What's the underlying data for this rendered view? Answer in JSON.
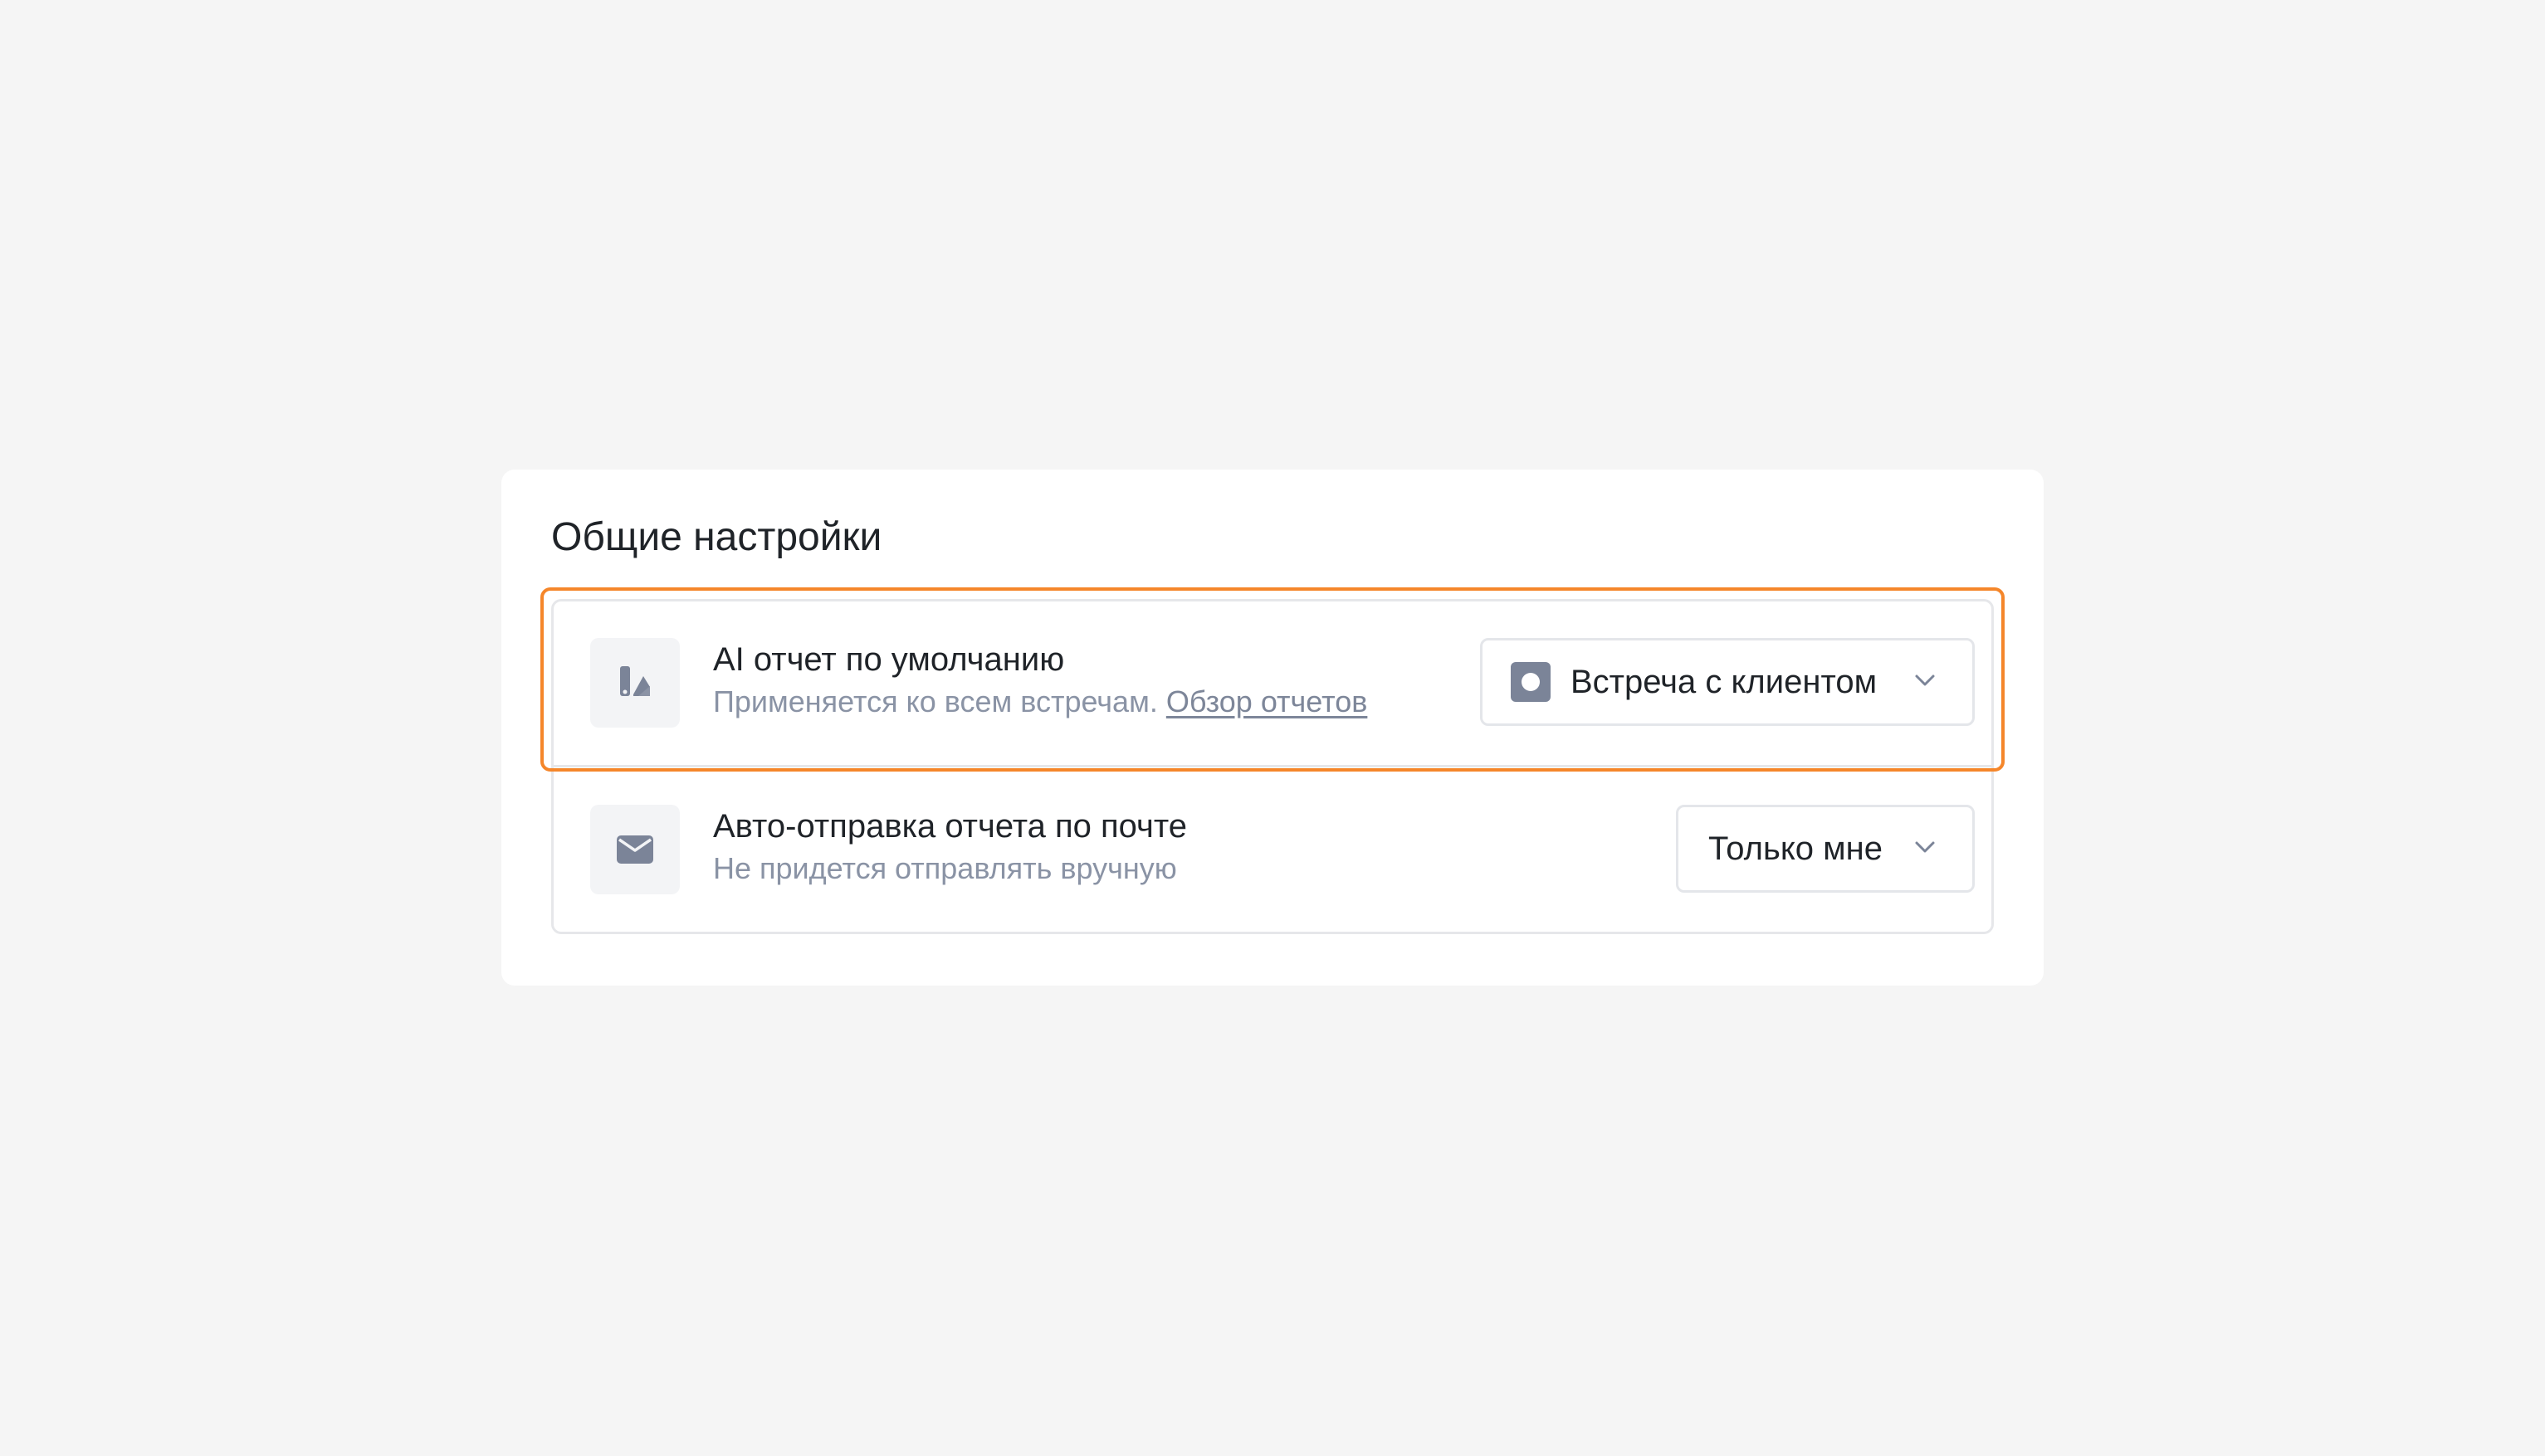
{
  "section": {
    "title": "Общие настройки"
  },
  "settings": [
    {
      "icon": "report-icon",
      "title": "AI отчет по умолчанию",
      "subtitle": "Применяется ко всем встречам.",
      "link_label": "Обзор отчетов",
      "select_value": "Встреча с клиентом",
      "highlighted": true
    },
    {
      "icon": "mail-icon",
      "title": "Авто-отправка отчета по почте",
      "subtitle": "Не придется отправлять вручную",
      "select_value": "Только мне",
      "highlighted": false
    }
  ],
  "colors": {
    "highlight": "#f5862a",
    "icon": "#7b8498",
    "muted_text": "#8a93a5"
  }
}
